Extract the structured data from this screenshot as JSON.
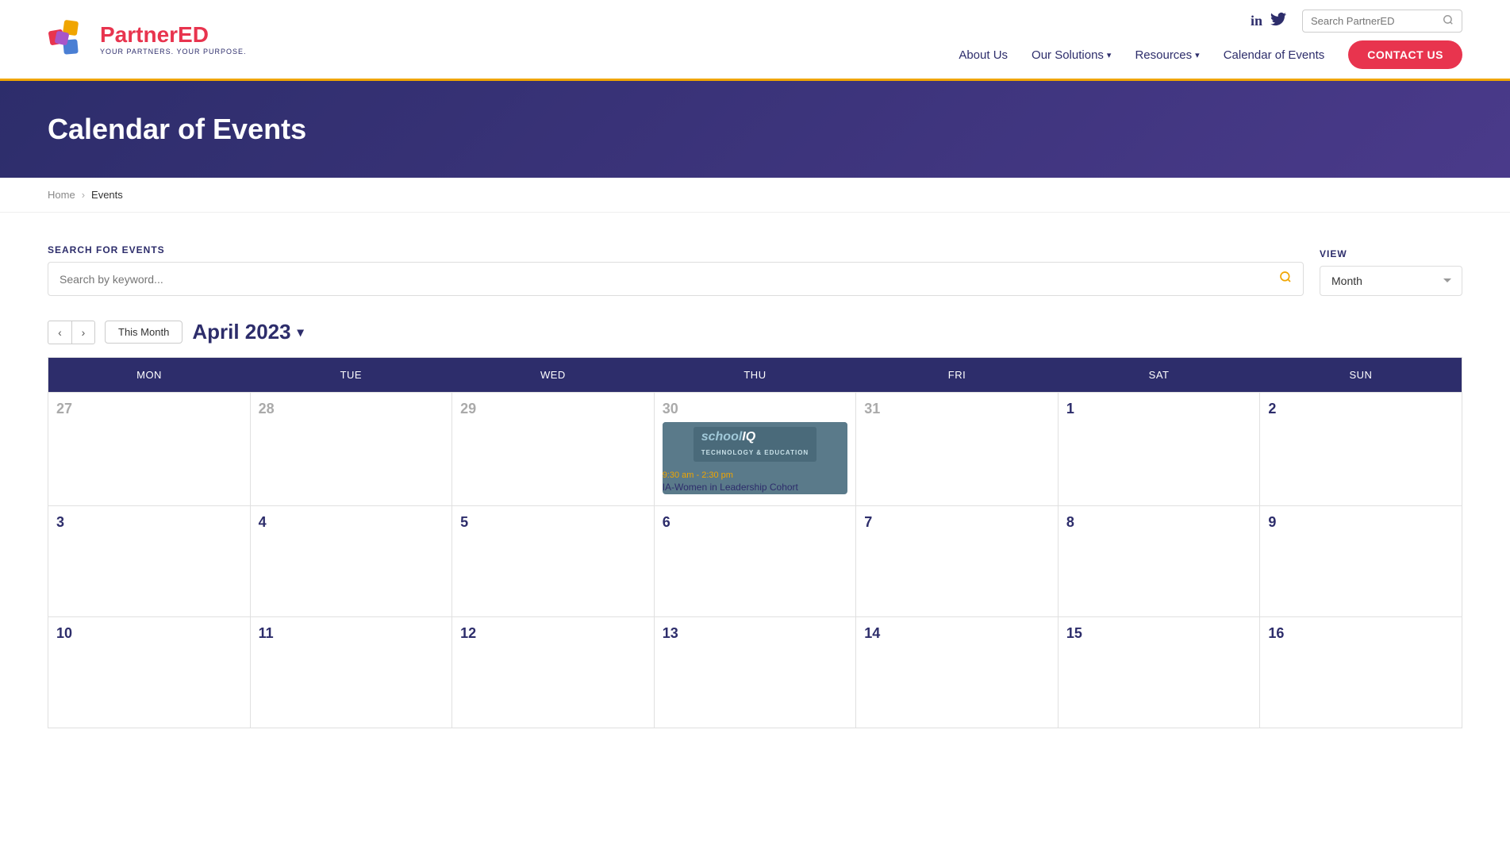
{
  "site": {
    "logo_name_part1": "Partner",
    "logo_name_part2": "ED",
    "logo_tagline": "YOUR PARTNERS. YOUR PURPOSE.",
    "search_placeholder": "Search PartnerED"
  },
  "nav": {
    "about_us": "About Us",
    "our_solutions": "Our Solutions",
    "resources": "Resources",
    "calendar": "Calendar of Events",
    "contact_us": "CONTACT US"
  },
  "social": {
    "linkedin": "in",
    "twitter": "🐦"
  },
  "hero": {
    "title": "Calendar of Events"
  },
  "breadcrumb": {
    "home": "Home",
    "current": "Events"
  },
  "search_section": {
    "label": "SEARCH FOR EVENTS",
    "placeholder": "Search by keyword...",
    "view_label": "VIEW",
    "view_default": "Month"
  },
  "calendar_nav": {
    "this_month": "This Month",
    "current_month": "April 2023"
  },
  "calendar": {
    "headers": [
      "MON",
      "TUE",
      "WED",
      "THU",
      "FRI",
      "SAT",
      "SUN"
    ],
    "weeks": [
      [
        {
          "date": "27",
          "other": true,
          "events": []
        },
        {
          "date": "28",
          "other": true,
          "events": []
        },
        {
          "date": "29",
          "other": true,
          "events": []
        },
        {
          "date": "30",
          "other": true,
          "events": [
            {
              "type": "schooliq",
              "time": "9:30 am - 2:30 pm",
              "title": "IA-Women in Leadership Cohort"
            }
          ]
        },
        {
          "date": "31",
          "other": true,
          "events": []
        },
        {
          "date": "1",
          "other": false,
          "events": []
        },
        {
          "date": "2",
          "other": false,
          "events": []
        }
      ],
      [
        {
          "date": "3",
          "other": false,
          "events": []
        },
        {
          "date": "4",
          "other": false,
          "events": []
        },
        {
          "date": "5",
          "other": false,
          "events": []
        },
        {
          "date": "6",
          "other": false,
          "events": []
        },
        {
          "date": "7",
          "other": false,
          "events": []
        },
        {
          "date": "8",
          "other": false,
          "events": []
        },
        {
          "date": "9",
          "other": false,
          "events": []
        }
      ],
      [
        {
          "date": "10",
          "other": false,
          "events": []
        },
        {
          "date": "11",
          "other": false,
          "events": []
        },
        {
          "date": "12",
          "other": false,
          "events": []
        },
        {
          "date": "13",
          "other": false,
          "events": []
        },
        {
          "date": "14",
          "other": false,
          "events": []
        },
        {
          "date": "15",
          "other": false,
          "events": []
        },
        {
          "date": "16",
          "other": false,
          "events": []
        }
      ]
    ]
  }
}
